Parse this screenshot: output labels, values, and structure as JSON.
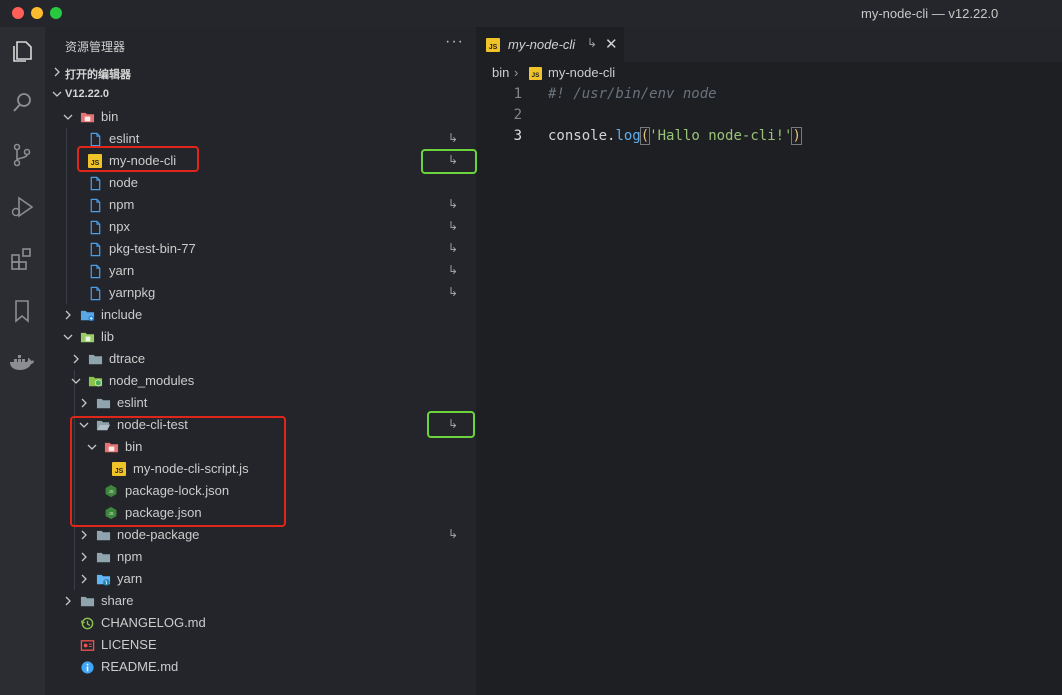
{
  "window": {
    "title": "my-node-cli — v12.22.0"
  },
  "sidebar": {
    "header": "资源管理器",
    "more": "···",
    "open_editors": "打开的编辑器",
    "root": "V12.22.0",
    "tree": [
      {
        "name": "bin",
        "icon": "folder-bin-icon",
        "open": true,
        "folder": true,
        "link": false
      },
      {
        "name": "eslint",
        "icon": "file-icon",
        "link": true
      },
      {
        "name": "my-node-cli",
        "icon": "js-file-icon",
        "link": true
      },
      {
        "name": "node",
        "icon": "file-icon",
        "link": false
      },
      {
        "name": "npm",
        "icon": "file-icon",
        "link": true
      },
      {
        "name": "npx",
        "icon": "file-icon",
        "link": true
      },
      {
        "name": "pkg-test-bin-77",
        "icon": "file-icon",
        "link": true
      },
      {
        "name": "yarn",
        "icon": "file-icon",
        "link": true
      },
      {
        "name": "yarnpkg",
        "icon": "file-icon",
        "link": true
      },
      {
        "name": "include",
        "icon": "folder-include-icon",
        "link": false
      },
      {
        "name": "lib",
        "icon": "folder-lib-icon",
        "link": false
      },
      {
        "name": "dtrace",
        "icon": "folder-icon",
        "link": false
      },
      {
        "name": "node_modules",
        "icon": "folder-node-icon",
        "link": false
      },
      {
        "name": "eslint",
        "icon": "folder-icon",
        "link": false
      },
      {
        "name": "node-cli-test",
        "icon": "folder-open-icon",
        "link": true
      },
      {
        "name": "bin",
        "icon": "folder-bin-icon",
        "link": false
      },
      {
        "name": "my-node-cli-script.js",
        "icon": "js-file-icon",
        "link": false
      },
      {
        "name": "package-lock.json",
        "icon": "nodejs-icon",
        "link": false
      },
      {
        "name": "package.json",
        "icon": "nodejs-icon",
        "link": false
      },
      {
        "name": "node-package",
        "icon": "folder-icon",
        "link": true
      },
      {
        "name": "npm",
        "icon": "folder-icon",
        "link": false
      },
      {
        "name": "yarn",
        "icon": "folder-yarn-icon",
        "link": false
      },
      {
        "name": "share",
        "icon": "folder-icon",
        "link": false
      },
      {
        "name": "CHANGELOG.md",
        "icon": "changelog-icon",
        "link": false
      },
      {
        "name": "LICENSE",
        "icon": "license-icon",
        "link": false
      },
      {
        "name": "README.md",
        "icon": "readme-icon",
        "link": false
      }
    ],
    "link_glyph": "↳"
  },
  "editor": {
    "tab": {
      "label": "my-node-cli",
      "arrow": "↳",
      "close": "✕"
    },
    "breadcrumb": {
      "folder": "bin",
      "sep": "›",
      "file": "my-node-cli"
    },
    "lines": [
      {
        "num": "1",
        "text": "#! /usr/bin/env node"
      },
      {
        "num": "2",
        "text": ""
      },
      {
        "num": "3",
        "text_obj": "console",
        "text_dot": ".",
        "text_fn": "log",
        "text_open": "(",
        "text_str": "'Hallo node-cli!'",
        "text_close": ")"
      }
    ]
  },
  "colors": {
    "annotation_red": "#e0261b",
    "annotation_green": "#6bd43a"
  }
}
